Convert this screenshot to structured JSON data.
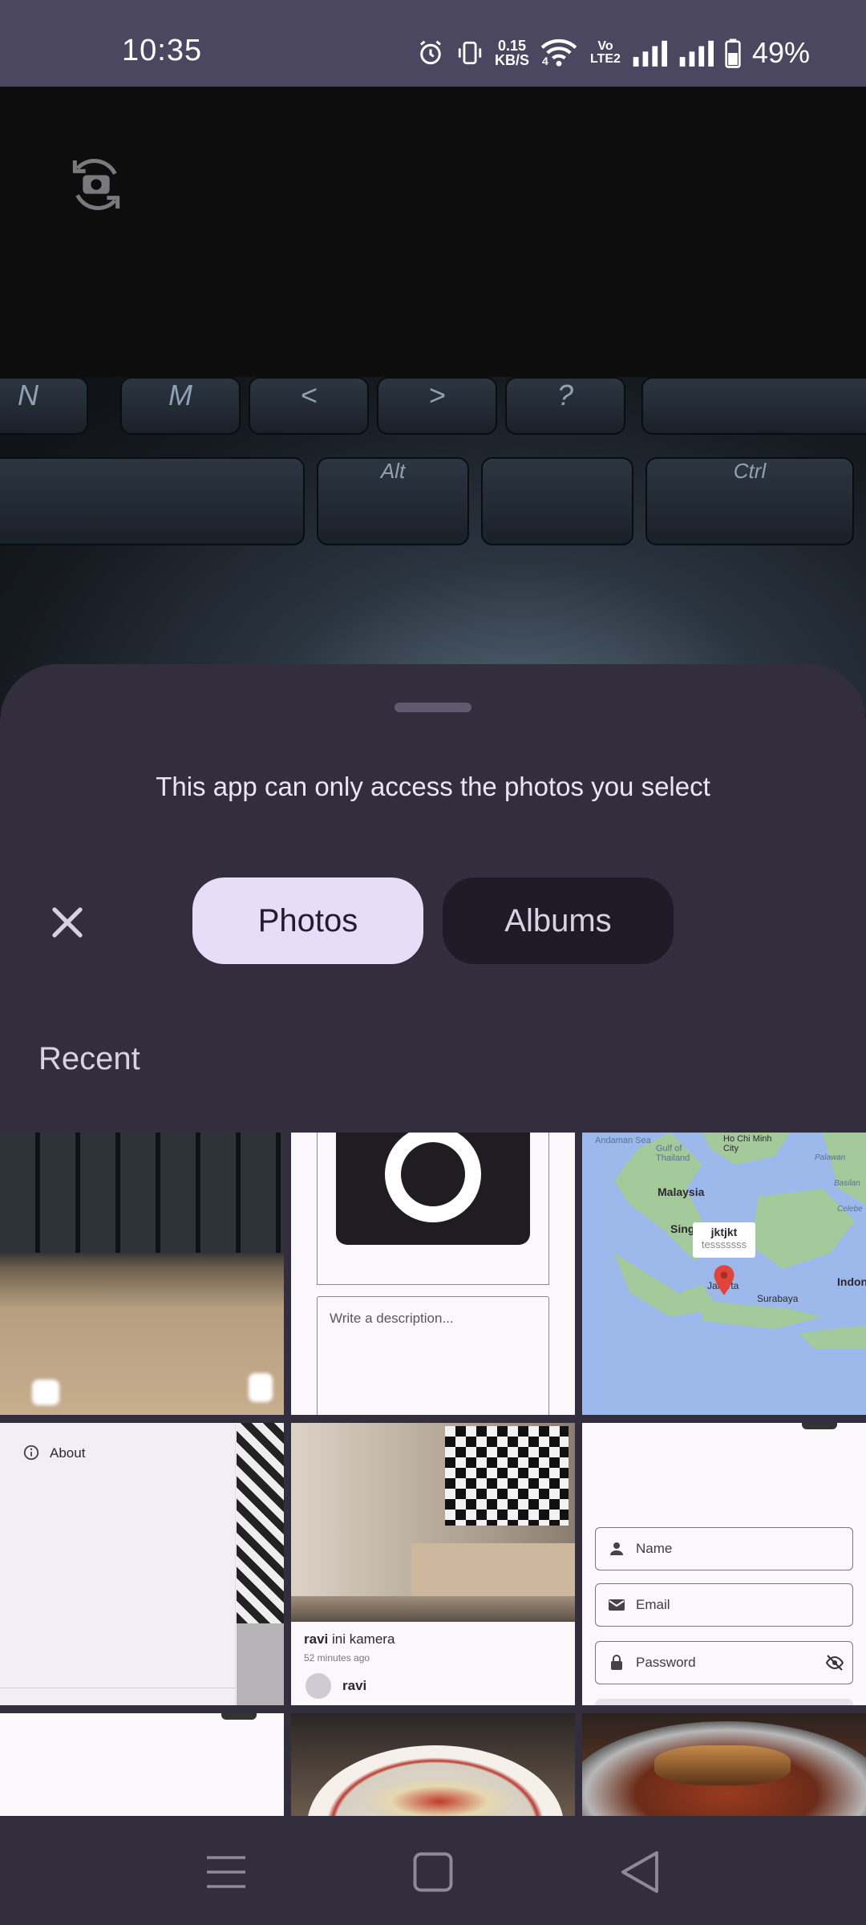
{
  "status_bar": {
    "time": "10:35",
    "net_speed_value": "0.15",
    "net_speed_unit": "KB/S",
    "volte_top": "Vo",
    "volte_bottom": "LTE2",
    "wifi_sub": "4",
    "battery_percent": "49%",
    "icons": [
      "alarm-icon",
      "vibrate-icon",
      "wifi-icon",
      "volte-icon",
      "signal-icon",
      "signal-icon",
      "battery-icon"
    ]
  },
  "camera_preview": {
    "rotate_icon": "rotate-camera-icon",
    "keys": [
      "N",
      "M",
      "<",
      ">",
      "?",
      "Alt",
      "Ctrl"
    ]
  },
  "picker": {
    "title": "This app can only access the photos you select",
    "close_icon": "close-icon",
    "tabs": [
      {
        "label": "Photos",
        "selected": true
      },
      {
        "label": "Albums",
        "selected": false
      }
    ],
    "section_label": "Recent",
    "colors": {
      "selected_tab": "#e8ddf8",
      "unselected_tab": "#1e1b26",
      "sheet": "#332e3e"
    }
  },
  "thumbnails": {
    "t2_description_placeholder": "Write a description...",
    "t3_map": {
      "marker_title": "jktjkt",
      "marker_subtitle": "tesssssss",
      "labels": [
        "Andaman Sea",
        "Gulf of Thailand",
        "Ho Chi Minh City",
        "Malaysia",
        "Sing",
        "Jakarta",
        "Surabaya",
        "Indon",
        "Palawan",
        "Basilan",
        "Celebe"
      ]
    },
    "t4_menu_item": "About",
    "t5_post": {
      "username": "ravi",
      "caption": "ini kamera",
      "time_ago": "52 minutes ago",
      "author": "ravi"
    },
    "t6_form": {
      "name_placeholder": "Name",
      "email_placeholder": "Email",
      "password_placeholder": "Password"
    }
  },
  "nav_bar": {
    "icons": [
      "menu-icon",
      "home-icon",
      "back-icon"
    ]
  }
}
